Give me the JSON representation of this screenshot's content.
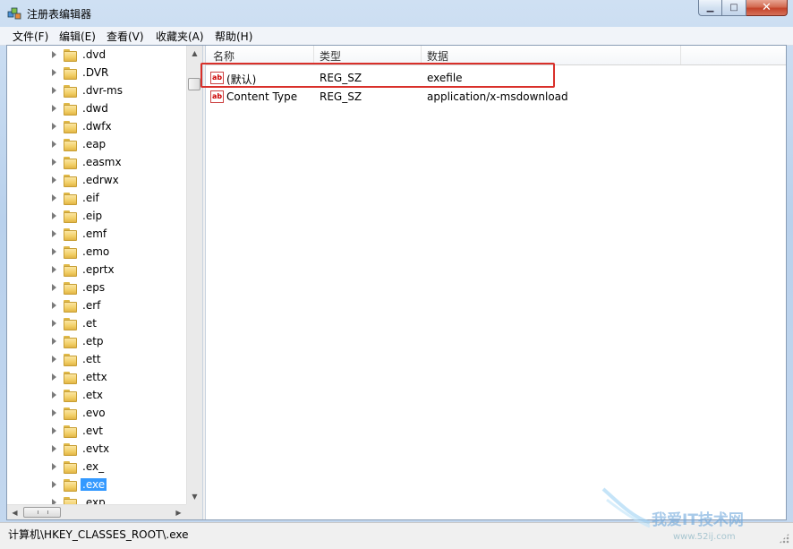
{
  "window": {
    "title": "注册表编辑器"
  },
  "menu": [
    "文件(F)",
    "编辑(E)",
    "查看(V)",
    "收藏夹(A)",
    "帮助(H)"
  ],
  "tree": {
    "items": [
      {
        "label": ".dvd"
      },
      {
        "label": ".DVR"
      },
      {
        "label": ".dvr-ms"
      },
      {
        "label": ".dwd"
      },
      {
        "label": ".dwfx"
      },
      {
        "label": ".eap"
      },
      {
        "label": ".easmx"
      },
      {
        "label": ".edrwx"
      },
      {
        "label": ".eif"
      },
      {
        "label": ".eip"
      },
      {
        "label": ".emf"
      },
      {
        "label": ".emo"
      },
      {
        "label": ".eprtx"
      },
      {
        "label": ".eps"
      },
      {
        "label": ".erf"
      },
      {
        "label": ".et"
      },
      {
        "label": ".etp"
      },
      {
        "label": ".ett"
      },
      {
        "label": ".ettx"
      },
      {
        "label": ".etx"
      },
      {
        "label": ".evo"
      },
      {
        "label": ".evt"
      },
      {
        "label": ".evtx"
      },
      {
        "label": ".ex_"
      },
      {
        "label": ".exe",
        "selected": true
      },
      {
        "label": ".exp"
      }
    ]
  },
  "list": {
    "columns": [
      "名称",
      "类型",
      "数据"
    ],
    "rows": [
      {
        "name": "(默认)",
        "type": "REG_SZ",
        "data": "exefile",
        "highlighted": true
      },
      {
        "name": "Content Type",
        "type": "REG_SZ",
        "data": "application/x-msdownload"
      }
    ]
  },
  "status": {
    "path": "计算机\\HKEY_CLASSES_ROOT\\.exe"
  },
  "watermark": {
    "text": "我爱IT技术网",
    "url": "www.52ij.com"
  },
  "colors": {
    "selection": "#3399ff",
    "highlight_box": "#d9302a"
  }
}
